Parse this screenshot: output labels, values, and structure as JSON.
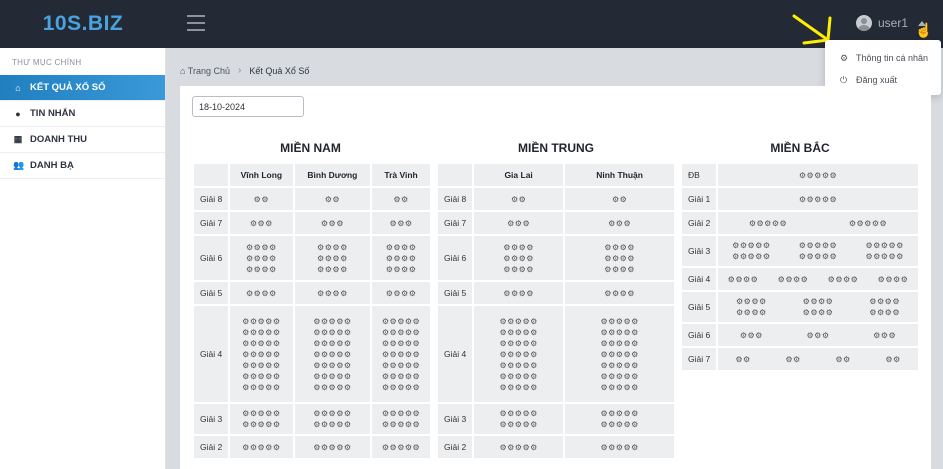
{
  "brand": "10S.BIZ",
  "topbar": {
    "username": "user1"
  },
  "dropdown": {
    "items": [
      {
        "label": "Thông tin cá nhân",
        "icon": "gear-icon"
      },
      {
        "label": "Đăng xuất",
        "icon": "logout-icon"
      }
    ]
  },
  "sidebar": {
    "header": "THƯ MỤC CHÍNH",
    "items": [
      {
        "label": "KẾT QUẢ XỔ SỐ",
        "icon": "home-icon",
        "active": true
      },
      {
        "label": "TIN NHẮN",
        "icon": "chat-icon",
        "active": false
      },
      {
        "label": "DOANH THU",
        "icon": "table-icon",
        "active": false
      },
      {
        "label": "DANH BẠ",
        "icon": "users-icon",
        "active": false
      }
    ]
  },
  "breadcrumb": {
    "home": "Trang Chủ",
    "current": "Kết Quả Xổ Số"
  },
  "date_value": "18-10-2024",
  "regions": {
    "nam": {
      "title": "MIỀN NAM",
      "columns": [
        "Vĩnh Long",
        "Bình Dương",
        "Trà Vinh"
      ],
      "rows": [
        {
          "label": "Giải 8",
          "cells": [
            [
              "⚙⚙"
            ],
            [
              "⚙⚙"
            ],
            [
              "⚙⚙"
            ]
          ]
        },
        {
          "label": "Giải 7",
          "cells": [
            [
              "⚙⚙⚙"
            ],
            [
              "⚙⚙⚙"
            ],
            [
              "⚙⚙⚙"
            ]
          ]
        },
        {
          "label": "Giải 6",
          "cells": [
            [
              "⚙⚙⚙⚙",
              "⚙⚙⚙⚙",
              "⚙⚙⚙⚙"
            ],
            [
              "⚙⚙⚙⚙",
              "⚙⚙⚙⚙",
              "⚙⚙⚙⚙"
            ],
            [
              "⚙⚙⚙⚙",
              "⚙⚙⚙⚙",
              "⚙⚙⚙⚙"
            ]
          ]
        },
        {
          "label": "Giải 5",
          "cells": [
            [
              "⚙⚙⚙⚙"
            ],
            [
              "⚙⚙⚙⚙"
            ],
            [
              "⚙⚙⚙⚙"
            ]
          ]
        },
        {
          "label": "Giải 4",
          "cells": [
            [
              "⚙⚙⚙⚙⚙",
              "⚙⚙⚙⚙⚙",
              "⚙⚙⚙⚙⚙",
              "⚙⚙⚙⚙⚙",
              "⚙⚙⚙⚙⚙",
              "⚙⚙⚙⚙⚙",
              "⚙⚙⚙⚙⚙"
            ],
            [
              "⚙⚙⚙⚙⚙",
              "⚙⚙⚙⚙⚙",
              "⚙⚙⚙⚙⚙",
              "⚙⚙⚙⚙⚙",
              "⚙⚙⚙⚙⚙",
              "⚙⚙⚙⚙⚙",
              "⚙⚙⚙⚙⚙"
            ],
            [
              "⚙⚙⚙⚙⚙",
              "⚙⚙⚙⚙⚙",
              "⚙⚙⚙⚙⚙",
              "⚙⚙⚙⚙⚙",
              "⚙⚙⚙⚙⚙",
              "⚙⚙⚙⚙⚙",
              "⚙⚙⚙⚙⚙"
            ]
          ]
        },
        {
          "label": "Giải 3",
          "cells": [
            [
              "⚙⚙⚙⚙⚙",
              "⚙⚙⚙⚙⚙"
            ],
            [
              "⚙⚙⚙⚙⚙",
              "⚙⚙⚙⚙⚙"
            ],
            [
              "⚙⚙⚙⚙⚙",
              "⚙⚙⚙⚙⚙"
            ]
          ]
        },
        {
          "label": "Giải 2",
          "cells": [
            [
              "⚙⚙⚙⚙⚙"
            ],
            [
              "⚙⚙⚙⚙⚙"
            ],
            [
              "⚙⚙⚙⚙⚙"
            ]
          ]
        }
      ]
    },
    "trung": {
      "title": "MIỀN TRUNG",
      "columns": [
        "Gia Lai",
        "Ninh Thuận"
      ],
      "rows": [
        {
          "label": "Giải 8",
          "cells": [
            [
              "⚙⚙"
            ],
            [
              "⚙⚙"
            ]
          ]
        },
        {
          "label": "Giải 7",
          "cells": [
            [
              "⚙⚙⚙"
            ],
            [
              "⚙⚙⚙"
            ]
          ]
        },
        {
          "label": "Giải 6",
          "cells": [
            [
              "⚙⚙⚙⚙",
              "⚙⚙⚙⚙",
              "⚙⚙⚙⚙"
            ],
            [
              "⚙⚙⚙⚙",
              "⚙⚙⚙⚙",
              "⚙⚙⚙⚙"
            ]
          ]
        },
        {
          "label": "Giải 5",
          "cells": [
            [
              "⚙⚙⚙⚙"
            ],
            [
              "⚙⚙⚙⚙"
            ]
          ]
        },
        {
          "label": "Giải 4",
          "cells": [
            [
              "⚙⚙⚙⚙⚙",
              "⚙⚙⚙⚙⚙",
              "⚙⚙⚙⚙⚙",
              "⚙⚙⚙⚙⚙",
              "⚙⚙⚙⚙⚙",
              "⚙⚙⚙⚙⚙",
              "⚙⚙⚙⚙⚙"
            ],
            [
              "⚙⚙⚙⚙⚙",
              "⚙⚙⚙⚙⚙",
              "⚙⚙⚙⚙⚙",
              "⚙⚙⚙⚙⚙",
              "⚙⚙⚙⚙⚙",
              "⚙⚙⚙⚙⚙",
              "⚙⚙⚙⚙⚙"
            ]
          ]
        },
        {
          "label": "Giải 3",
          "cells": [
            [
              "⚙⚙⚙⚙⚙",
              "⚙⚙⚙⚙⚙"
            ],
            [
              "⚙⚙⚙⚙⚙",
              "⚙⚙⚙⚙⚙"
            ]
          ]
        },
        {
          "label": "Giải 2",
          "cells": [
            [
              "⚙⚙⚙⚙⚙"
            ],
            [
              "⚙⚙⚙⚙⚙"
            ]
          ]
        }
      ]
    },
    "bac": {
      "title": "MIỀN BẮC",
      "rows": [
        {
          "label": "ĐB",
          "lines": [
            [
              "⚙⚙⚙⚙⚙"
            ]
          ]
        },
        {
          "label": "Giải 1",
          "lines": [
            [
              "⚙⚙⚙⚙⚙"
            ]
          ]
        },
        {
          "label": "Giải 2",
          "lines": [
            [
              "⚙⚙⚙⚙⚙",
              "⚙⚙⚙⚙⚙"
            ]
          ]
        },
        {
          "label": "Giải 3",
          "lines": [
            [
              "⚙⚙⚙⚙⚙",
              "⚙⚙⚙⚙⚙",
              "⚙⚙⚙⚙⚙"
            ],
            [
              "⚙⚙⚙⚙⚙",
              "⚙⚙⚙⚙⚙",
              "⚙⚙⚙⚙⚙"
            ]
          ]
        },
        {
          "label": "Giải 4",
          "lines": [
            [
              "⚙⚙⚙⚙",
              "⚙⚙⚙⚙",
              "⚙⚙⚙⚙",
              "⚙⚙⚙⚙"
            ]
          ]
        },
        {
          "label": "Giải 5",
          "lines": [
            [
              "⚙⚙⚙⚙",
              "⚙⚙⚙⚙",
              "⚙⚙⚙⚙"
            ],
            [
              "⚙⚙⚙⚙",
              "⚙⚙⚙⚙",
              "⚙⚙⚙⚙"
            ]
          ]
        },
        {
          "label": "Giải 6",
          "lines": [
            [
              "⚙⚙⚙",
              "⚙⚙⚙",
              "⚙⚙⚙"
            ]
          ]
        },
        {
          "label": "Giải 7",
          "lines": [
            [
              "⚙⚙",
              "⚙⚙",
              "⚙⚙",
              "⚙⚙"
            ]
          ]
        }
      ]
    }
  }
}
